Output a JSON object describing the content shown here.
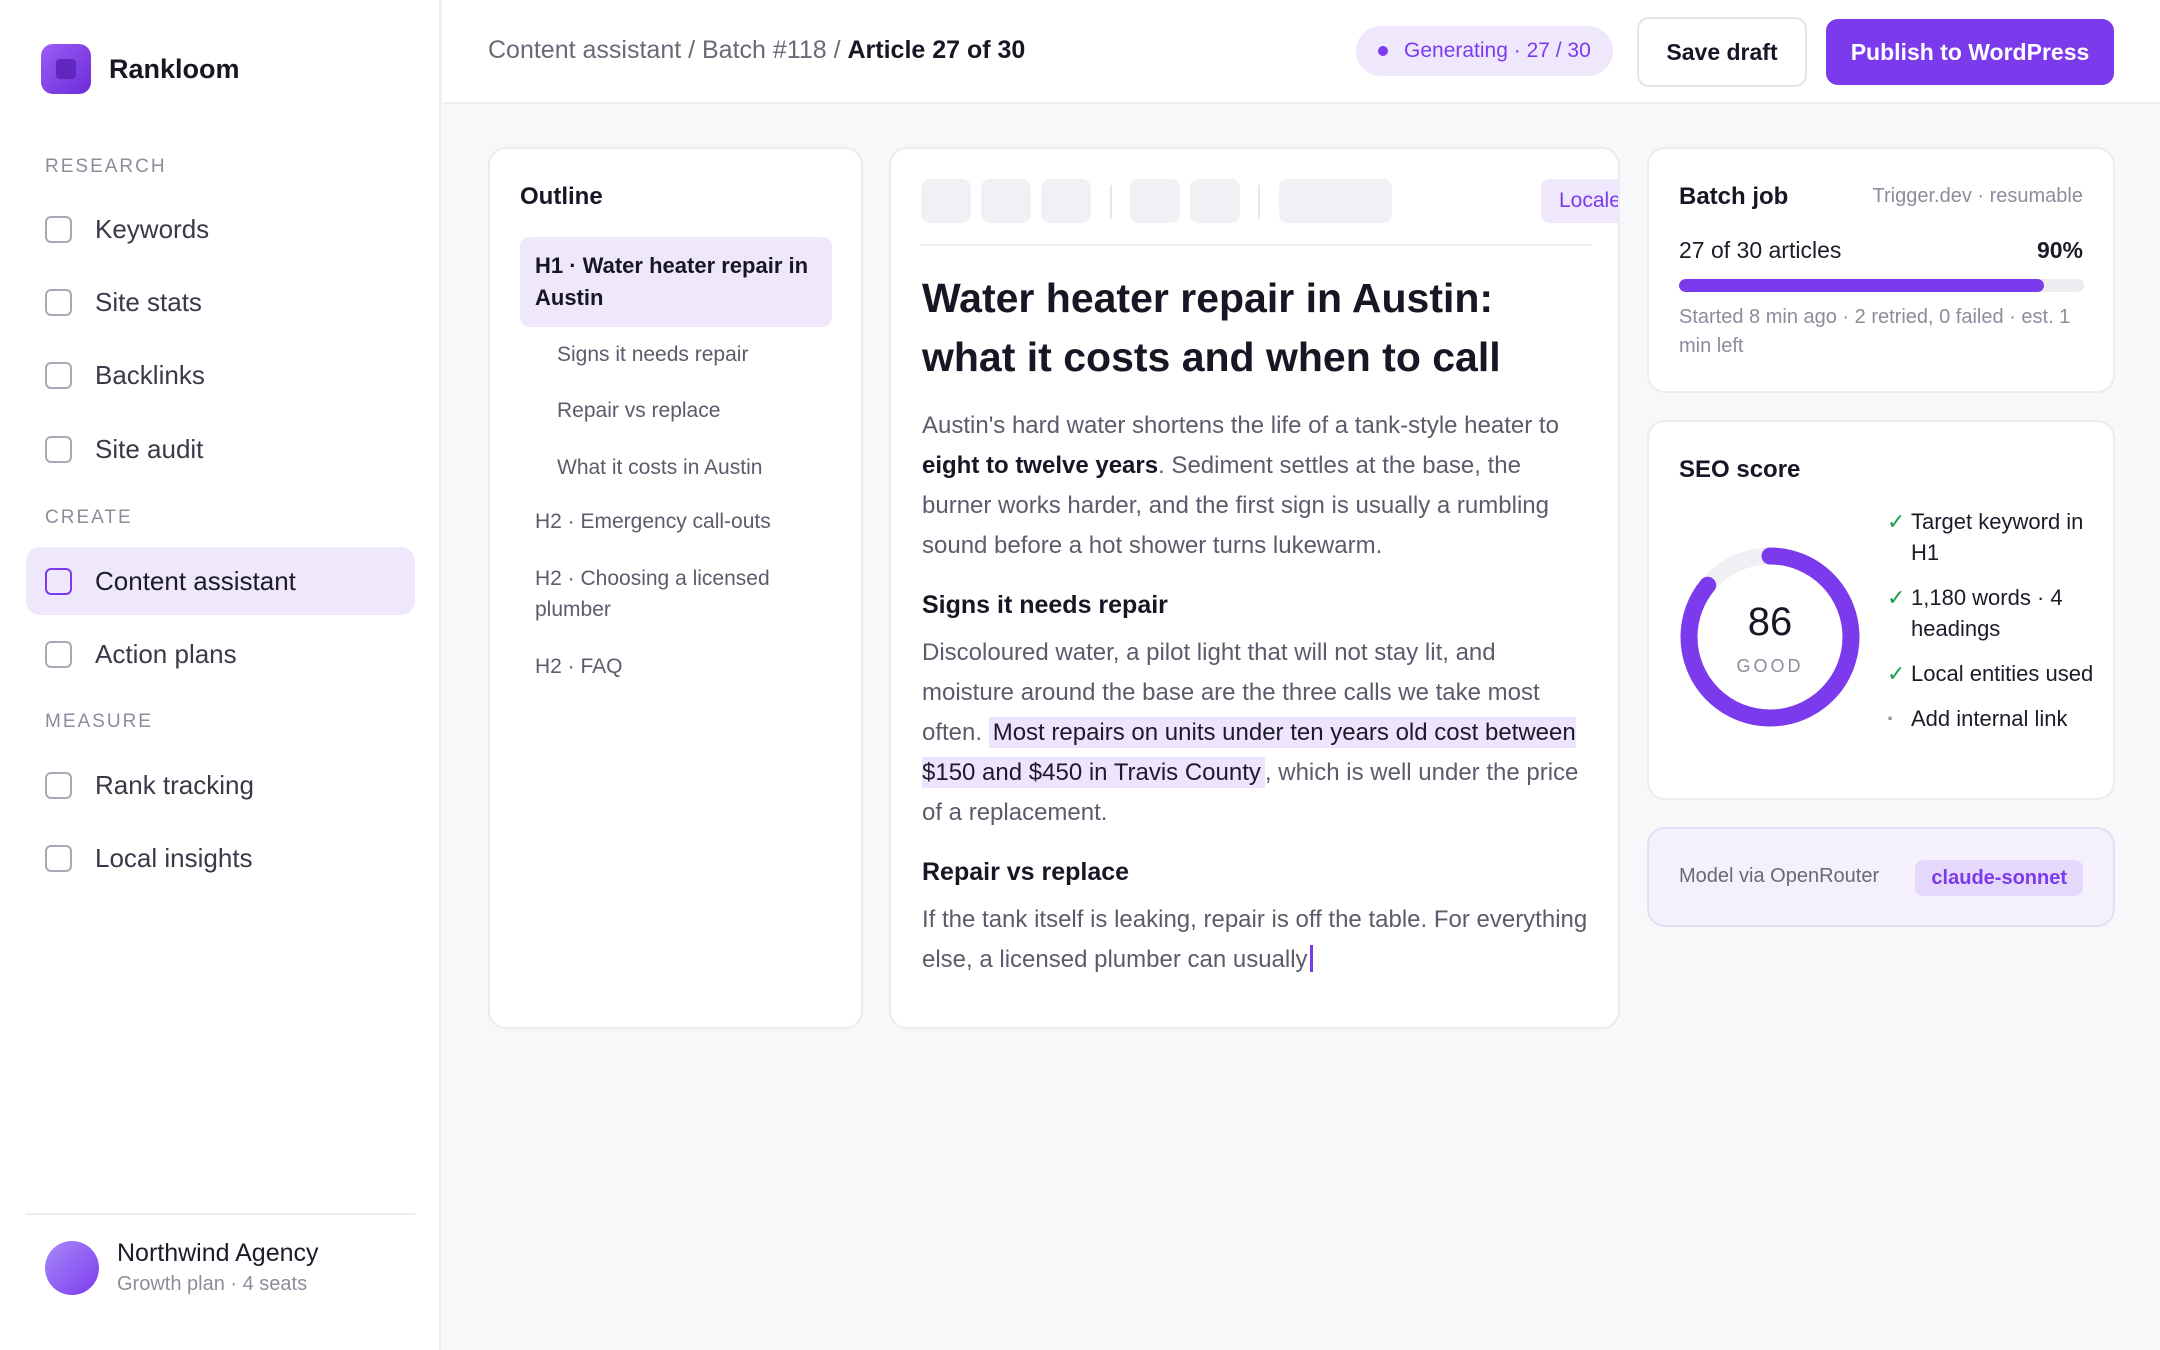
{
  "app": {
    "name": "Rankloom"
  },
  "sidebar": {
    "sections": [
      {
        "label": "RESEARCH",
        "items": [
          {
            "label": "Keywords"
          },
          {
            "label": "Site stats"
          },
          {
            "label": "Backlinks"
          },
          {
            "label": "Site audit"
          }
        ]
      },
      {
        "label": "CREATE",
        "items": [
          {
            "label": "Content assistant",
            "active": true
          },
          {
            "label": "Action plans"
          }
        ]
      },
      {
        "label": "MEASURE",
        "items": [
          {
            "label": "Rank tracking"
          },
          {
            "label": "Local insights"
          }
        ]
      }
    ],
    "account": {
      "name": "Northwind Agency",
      "plan": "Growth plan · 4 seats"
    }
  },
  "header": {
    "crumb_path": "Content assistant / Batch #118 / ",
    "crumb_current": "Article 27 of 30",
    "status": "Generating · 27 / 30",
    "save_label": "Save draft",
    "publish_label": "Publish to WordPress"
  },
  "outline": {
    "title": "Outline",
    "items": [
      "H1 · Water heater repair in Austin",
      "Signs it needs repair",
      "Repair vs replace",
      "What it costs in Austin",
      "H2 · Emergency call-outs",
      "H2 · Choosing a licensed plumber",
      "H2 · FAQ"
    ]
  },
  "editor": {
    "locale": "Locale: en-US",
    "title": "Water heater repair in Austin: what it costs and when to call",
    "p1_a": "Austin's hard water shortens the life of a tank-style heater to ",
    "p1_bold": "eight to twelve years",
    "p1_b": ". Sediment settles at the base, the burner works harder, and the first sign is usually a rumbling sound before a hot shower turns lukewarm.",
    "h2_1": "Signs it needs repair",
    "p2_a": "Discoloured water, a pilot light that will not stay lit, and moisture around the base are the three calls we take most often. ",
    "p2_mark": "Most repairs on units under ten years old cost between $150 and $450 in Travis County",
    "p2_b": ", which is well under the price of a replacement.",
    "h2_2": "Repair vs replace",
    "p3": "If the tank itself is leaking, repair is off the table. For everything else, a licensed plumber can usually"
  },
  "batch": {
    "title": "Batch job",
    "meta": "Trigger.dev · resumable",
    "count": "27 of 30 articles",
    "percent_label": "90%",
    "progress": 0.9,
    "note": "Started 8 min ago · 2 retried, 0 failed · est. 1 min left"
  },
  "seo": {
    "title": "SEO score",
    "score": 86,
    "score_max": 100,
    "rating": "GOOD",
    "checks": [
      {
        "label": "Target keyword in H1",
        "done": true
      },
      {
        "label": "1,180 words · 4 headings",
        "done": true
      },
      {
        "label": "Local entities used",
        "done": true
      },
      {
        "label": "Add internal link",
        "done": false
      }
    ]
  },
  "model": {
    "label": "Model via OpenRouter",
    "name": "claude-sonnet"
  },
  "icons": {
    "check": "check-icon",
    "todo": "dot-icon"
  },
  "colors": {
    "accent": "#7c3aed",
    "accent_soft": "#efe8fd",
    "success": "#16a34a"
  }
}
